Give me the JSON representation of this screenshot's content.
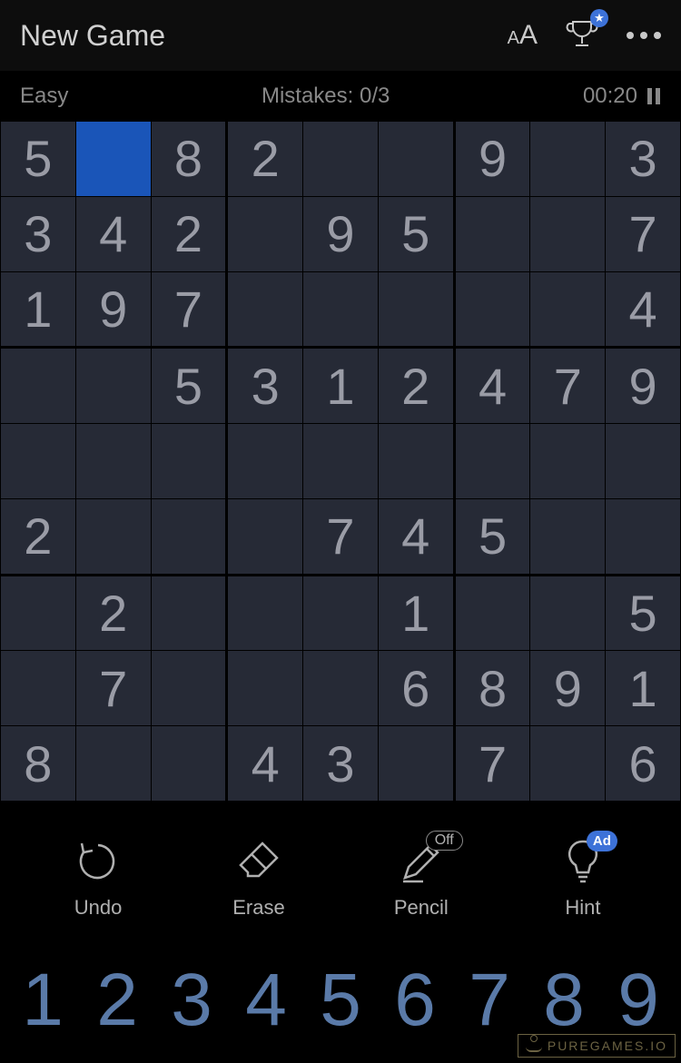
{
  "header": {
    "title": "New Game",
    "trophy_star": "★"
  },
  "status": {
    "difficulty": "Easy",
    "mistakes_label": "Mistakes: 0/3",
    "timer": "00:20"
  },
  "board": [
    [
      "5",
      "",
      "8",
      "2",
      "",
      "",
      "9",
      "",
      "3"
    ],
    [
      "3",
      "4",
      "2",
      "",
      "9",
      "5",
      "",
      "",
      "7"
    ],
    [
      "1",
      "9",
      "7",
      "",
      "",
      "",
      "",
      "",
      "4"
    ],
    [
      "",
      "",
      "5",
      "3",
      "1",
      "2",
      "4",
      "7",
      "9"
    ],
    [
      "",
      "",
      "",
      "",
      "",
      "",
      "",
      "",
      ""
    ],
    [
      "2",
      "",
      "",
      "",
      "7",
      "4",
      "5",
      "",
      ""
    ],
    [
      "",
      "2",
      "",
      "",
      "",
      "1",
      "",
      "",
      "5"
    ],
    [
      "",
      "7",
      "",
      "",
      "",
      "6",
      "8",
      "9",
      "1"
    ],
    [
      "8",
      "",
      "",
      "4",
      "3",
      "",
      "7",
      "",
      "6"
    ]
  ],
  "selected": {
    "row": 0,
    "col": 1
  },
  "tools": {
    "undo": "Undo",
    "erase": "Erase",
    "pencil": "Pencil",
    "pencil_state": "Off",
    "hint": "Hint",
    "hint_badge": "Ad"
  },
  "numpad": [
    "1",
    "2",
    "3",
    "4",
    "5",
    "6",
    "7",
    "8",
    "9"
  ],
  "watermark": "PUREGAMES.IO"
}
